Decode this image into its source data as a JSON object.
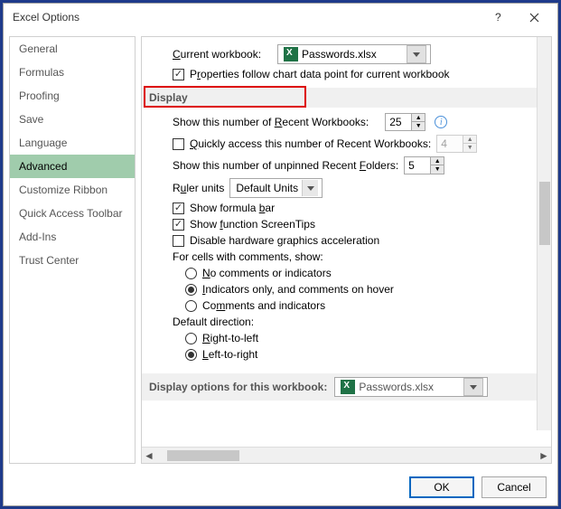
{
  "window": {
    "title": "Excel Options"
  },
  "sidebar": {
    "items": [
      {
        "label": "General"
      },
      {
        "label": "Formulas"
      },
      {
        "label": "Proofing"
      },
      {
        "label": "Save"
      },
      {
        "label": "Language"
      },
      {
        "label": "Advanced"
      },
      {
        "label": "Customize Ribbon"
      },
      {
        "label": "Quick Access Toolbar"
      },
      {
        "label": "Add-Ins"
      },
      {
        "label": "Trust Center"
      }
    ],
    "selected": "Advanced"
  },
  "panel": {
    "current_workbook_label": "Current workbook:",
    "current_workbook_value": "Passwords.xlsx",
    "props_follow_chart": "Properties follow chart data point for current workbook",
    "display_heading": "Display",
    "recent_workbooks_label": "Show this number of Recent Workbooks:",
    "recent_workbooks_value": "25",
    "quick_access_label": "Quickly access this number of Recent Workbooks:",
    "quick_access_value": "4",
    "recent_folders_label": "Show this number of unpinned Recent Folders:",
    "recent_folders_value": "5",
    "ruler_units_label": "Ruler units",
    "ruler_units_value": "Default Units",
    "show_formula_bar": "Show formula bar",
    "show_screentips": "Show function ScreenTips",
    "disable_hw": "Disable hardware graphics acceleration",
    "comments_heading": "For cells with comments, show:",
    "comments_none": "No comments or indicators",
    "comments_ind": "Indicators only, and comments on hover",
    "comments_all": "Comments and indicators",
    "direction_heading": "Default direction:",
    "direction_rtl": "Right-to-left",
    "direction_ltr": "Left-to-right",
    "display_workbook_heading": "Display options for this workbook:",
    "display_workbook_value": "Passwords.xlsx"
  },
  "footer": {
    "ok": "OK",
    "cancel": "Cancel"
  }
}
